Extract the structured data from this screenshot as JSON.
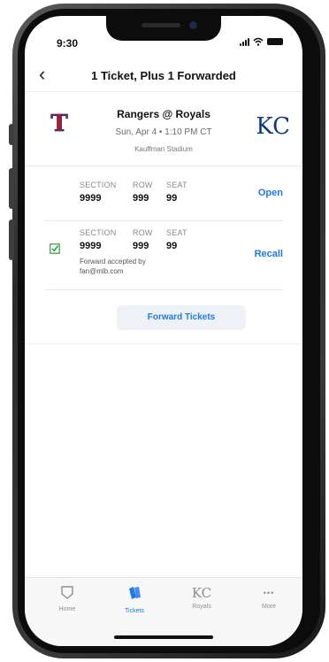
{
  "status_bar": {
    "time": "9:30"
  },
  "header": {
    "title": "1 Ticket, Plus 1 Forwarded",
    "back_glyph": "‹"
  },
  "game": {
    "matchup": "Rangers @ Royals",
    "datetime": "Sun, Apr 4 • 1:10 PM CT",
    "venue": "Kauffman Stadium",
    "away_logo": "T",
    "home_logo": "KC",
    "away_color": "#c0111f",
    "home_color": "#0a3a87"
  },
  "tickets": [
    {
      "labels": {
        "section": "SECTION",
        "row": "ROW",
        "seat": "SEAT"
      },
      "section": "9999",
      "row": "999",
      "seat": "99",
      "action": "Open"
    },
    {
      "labels": {
        "section": "SECTION",
        "row": "ROW",
        "seat": "SEAT"
      },
      "section": "9999",
      "row": "999",
      "seat": "99",
      "action": "Recall",
      "note_line1": "Forward accepted by",
      "note_line2": "fan@mlb.com"
    }
  ],
  "forward_button": "Forward Tickets",
  "tabbar": {
    "home": "Home",
    "tickets": "Tickets",
    "royals": "Royals",
    "royals_logo": "KC",
    "more": "More",
    "more_glyph": "•••"
  },
  "colors": {
    "accent": "#1f7ae6",
    "check": "#2e9b3a"
  }
}
